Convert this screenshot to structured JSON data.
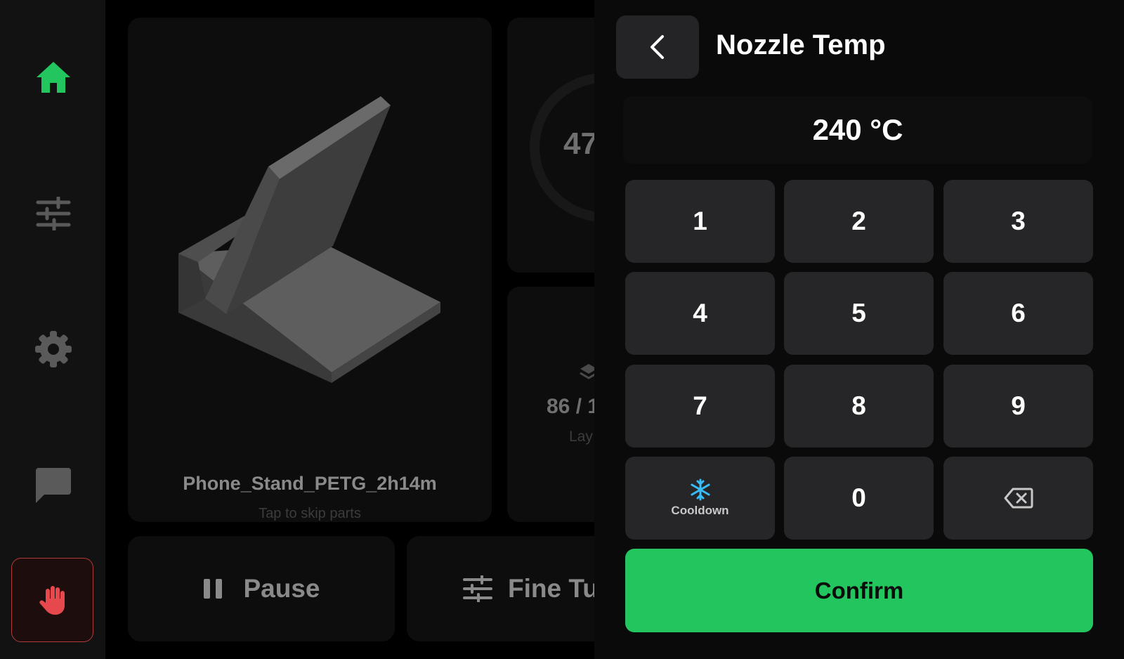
{
  "colors": {
    "accent_green": "#22c55e",
    "estop_red": "#e5484d",
    "cooldown_blue": "#38bdf8"
  },
  "sidebar": {
    "items": [
      {
        "icon": "home-icon",
        "active": true
      },
      {
        "icon": "sliders-icon",
        "active": false
      },
      {
        "icon": "gear-icon",
        "active": false
      },
      {
        "icon": "chat-icon",
        "active": false
      }
    ],
    "estop_icon": "hand-stop-icon"
  },
  "job": {
    "file_name": "Phone_Stand_PETG_2h14m",
    "hint": "Tap to skip parts",
    "progress_text": "47",
    "layer_text": "86 / 1",
    "layer_label": "Lay"
  },
  "actions": {
    "pause_label": "Pause",
    "fine_tune_label": "Fine Tu"
  },
  "keypad": {
    "title": "Nozzle Temp",
    "value": "240 °C",
    "keys": [
      "1",
      "2",
      "3",
      "4",
      "5",
      "6",
      "7",
      "8",
      "9",
      "0"
    ],
    "cooldown_label": "Cooldown",
    "confirm_label": "Confirm"
  }
}
